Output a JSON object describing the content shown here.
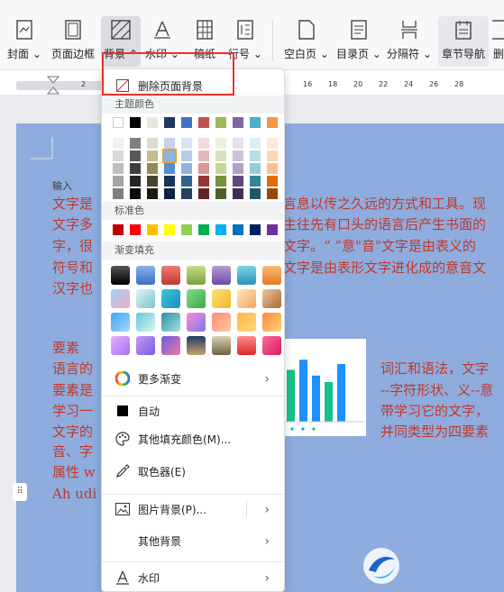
{
  "toolbar": {
    "cover": "封面",
    "page_border": "页面边框",
    "background": "背景",
    "watermark": "水印",
    "manuscript": "稿纸",
    "line_number": "行号",
    "blank_page": "空白页",
    "toc_page": "目录页",
    "separator": "分隔符",
    "chapter_nav": "章节导航",
    "cut": "删"
  },
  "ruler": {
    "ticks": [
      "2",
      "16",
      "18",
      "20",
      "22",
      "24",
      "26",
      "28"
    ]
  },
  "document": {
    "input_hint": "输入",
    "left_lines": [
      "文字是",
      "文字多",
      "字，很",
      "符号和",
      "汉字也"
    ],
    "right_lines": [
      "言息以传之久远的方式和工具。现",
      "主往先有口头的语言后产生书面的",
      "文字。“ ”意\"音\"文字是由表义的",
      "文字是由表形文字进化成的意音文"
    ],
    "heading": "要素",
    "left2_lines": [
      "语言的",
      "要素是",
      "学习一",
      "文字的",
      "音、字",
      "属性 w",
      "Ah udi"
    ],
    "right2_lines": [
      "词汇和语法，文字",
      "--字符形状、义--意",
      "带学习它的文字，",
      "并同类型为四要素"
    ]
  },
  "chart_data": {
    "type": "bar",
    "categories": [
      "",
      "",
      "",
      "",
      ""
    ],
    "series": [
      {
        "values": [
          72,
          86,
          64,
          55,
          80
        ]
      }
    ],
    "colors": [
      "#16c08a",
      "#1e90ff",
      "#1e90ff",
      "#16c08a",
      "#1e90ff"
    ]
  },
  "menu": {
    "remove_bg": "删除页面背景",
    "theme_colors": "主题颜色",
    "standard_colors": "标准色",
    "gradient_fill": "渐变填充",
    "more_gradient": "更多渐变",
    "auto": "自动",
    "other_fill": "其他填充颜色(M)...",
    "eyedropper": "取色器(E)",
    "picture_bg": "图片背景(P)...",
    "other_bg": "其他背景",
    "watermark": "水印"
  },
  "colors": {
    "theme_top": [
      "#ffffff",
      "#000000",
      "#e8e6dd",
      "#1f3864",
      "#4472c4",
      "#c0504d",
      "#9bbb59",
      "#8064a2",
      "#4bacc6",
      "#f79646"
    ],
    "theme_shades": [
      [
        "#f2f2f2",
        "#7f7f7f",
        "#dddad0",
        "#c6d0e8",
        "#dbe4f3",
        "#f2dcdb",
        "#ebf1dd",
        "#e5e0ec",
        "#dbeef3",
        "#fde9d9"
      ],
      [
        "#d8d8d8",
        "#595959",
        "#c4bd97",
        "#8db3e2",
        "#b8cce4",
        "#e6b8b7",
        "#d7e3bc",
        "#ccc1d9",
        "#b7dde8",
        "#fbd5b5"
      ],
      [
        "#bfbfbf",
        "#3f3f3f",
        "#948a54",
        "#548dd4",
        "#95b3d7",
        "#d99694",
        "#c3d69b",
        "#b2a2c7",
        "#92cddc",
        "#fac08f"
      ],
      [
        "#a5a5a5",
        "#262626",
        "#4a452a",
        "#17365d",
        "#366092",
        "#953734",
        "#76923c",
        "#5f497a",
        "#31859b",
        "#e36c09"
      ],
      [
        "#7f7f7f",
        "#0c0c0c",
        "#1d1b10",
        "#0f243e",
        "#244061",
        "#632523",
        "#4f6128",
        "#3f3151",
        "#205867",
        "#974806"
      ]
    ],
    "standard": [
      "#c00000",
      "#ff0000",
      "#ffc000",
      "#ffff00",
      "#92d050",
      "#00b050",
      "#00b0f0",
      "#0070c0",
      "#002060",
      "#7030a0"
    ],
    "gradients": [
      [
        "linear-gradient(#555,#000)",
        "linear-gradient(#8ab0e8,#3a6fc4)",
        "linear-gradient(#f07a76,#c0392b)",
        "linear-gradient(#c3dc8c,#7aa33a)",
        "linear-gradient(#b79bd6,#6c4aa3)",
        "linear-gradient(#7ed3e6,#2b93b3)",
        "linear-gradient(#fbbe7a,#e5781e)"
      ],
      [
        "linear-gradient(135deg,#9fd3f5,#f5a7c8)",
        "linear-gradient(135deg,#dff3f3,#7ac6cf)",
        "linear-gradient(135deg,#3cc8d6,#1a8ec0)",
        "linear-gradient(135deg,#7fe08a,#3aa845)",
        "linear-gradient(135deg,#ffe27a,#f0b52a)",
        "linear-gradient(135deg,#fde7c6,#f5a45a)",
        "linear-gradient(135deg,#f0c49a,#a86a3a)"
      ],
      [
        "linear-gradient(135deg,#3fa4f5,#a2d8f8)",
        "linear-gradient(135deg,#5ec9d6,#e0f4f4)",
        "linear-gradient(135deg,#2a8f9e,#a4e0e2)",
        "linear-gradient(135deg,#ff8ad0,#7a7af0)",
        "linear-gradient(135deg,#ff8a7a,#ffc8a0)",
        "linear-gradient(135deg,#ffb74a,#ffd77a)",
        "linear-gradient(135deg,#ff8a3a,#ffd27a)"
      ],
      [
        "linear-gradient(135deg,#e6b3ff,#a96ef0)",
        "linear-gradient(135deg,#c59af5,#7a5ae6)",
        "linear-gradient(135deg,#6a5ae0,#f07aa0)",
        "linear-gradient(#1e3a6a,#c9a06a)",
        "linear-gradient(#d9d2b3,#6d6140)",
        "linear-gradient(#ff8a8a,#d62a2a)",
        "linear-gradient(135deg,#ff6aa0,#d61a5a)"
      ]
    ]
  }
}
